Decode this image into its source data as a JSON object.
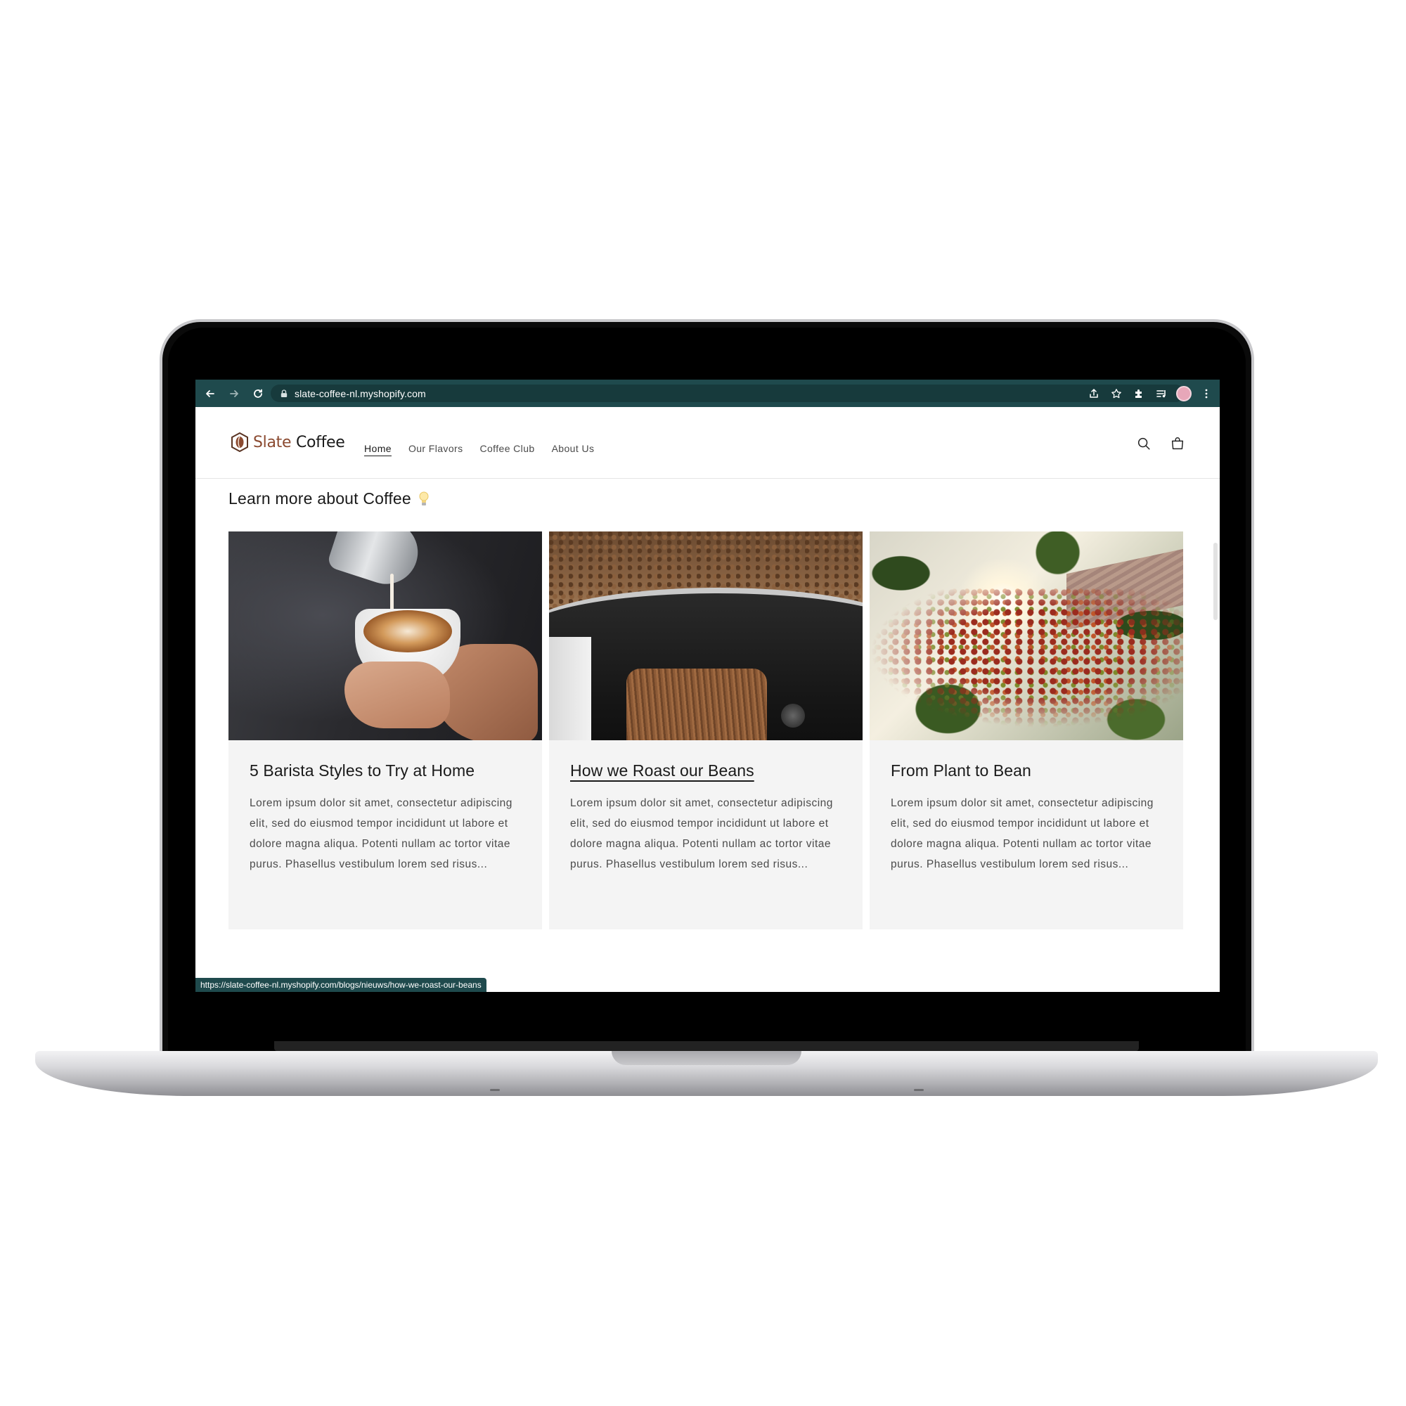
{
  "browser": {
    "url": "slate-coffee-nl.myshopify.com",
    "status_url": "https://slate-coffee-nl.myshopify.com/blogs/nieuws/how-we-roast-our-beans",
    "chrome_color": "#1f4a4d"
  },
  "store": {
    "logo_part1": "Slate",
    "logo_part2": "Coffee",
    "brand_color": "#8b4a30",
    "nav": [
      {
        "label": "Home",
        "active": true
      },
      {
        "label": "Our Flavors",
        "active": false
      },
      {
        "label": "Coffee Club",
        "active": false
      },
      {
        "label": "About Us",
        "active": false
      }
    ],
    "icons": [
      "search-icon",
      "cart-icon"
    ]
  },
  "section": {
    "title": "Learn more about Coffee",
    "title_icon": "lightbulb-icon"
  },
  "articles": [
    {
      "title": "5 Barista Styles to Try at Home",
      "excerpt": "Lorem ipsum dolor sit amet, consectetur adipiscing elit, sed do eiusmod tempor incididunt ut labore et dolore magna aliqua. Potenti nullam ac tortor vitae purus. Phasellus vestibulum lorem sed risus...",
      "image": "latte-art-photo",
      "hovered": false
    },
    {
      "title": "How we Roast our Beans",
      "excerpt": "Lorem ipsum dolor sit amet, consectetur adipiscing elit, sed do eiusmod tempor incididunt ut labore et dolore magna aliqua. Potenti nullam ac tortor vitae purus. Phasellus vestibulum lorem sed risus...",
      "image": "coffee-roaster-photo",
      "hovered": true
    },
    {
      "title": "From Plant to Bean",
      "excerpt": "Lorem ipsum dolor sit amet, consectetur adipiscing elit, sed do eiusmod tempor incididunt ut labore et dolore magna aliqua. Potenti nullam ac tortor vitae purus. Phasellus vestibulum lorem sed risus...",
      "image": "coffee-plant-photo",
      "hovered": false
    }
  ]
}
